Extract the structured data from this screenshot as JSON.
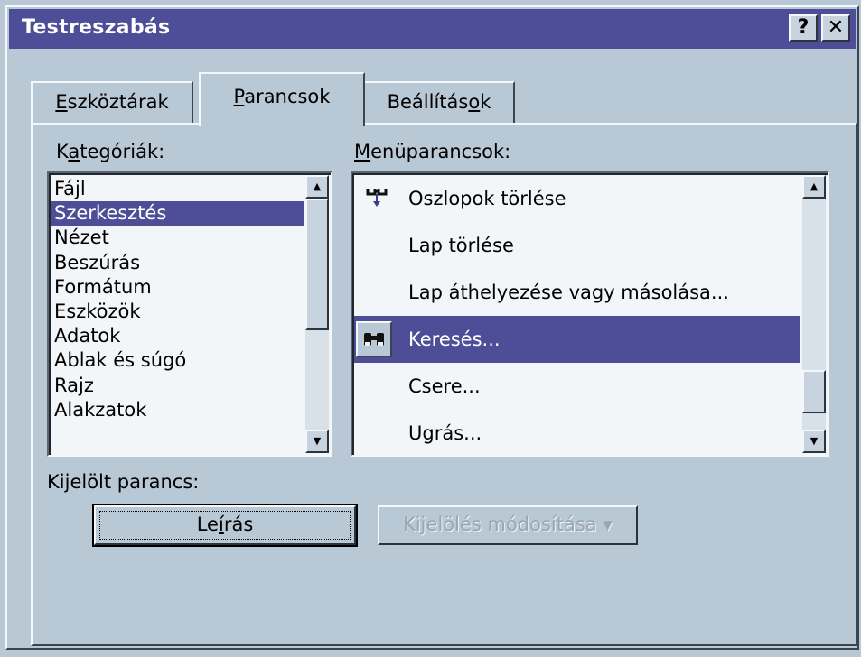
{
  "window": {
    "title": "Testreszabás",
    "help_label": "?",
    "close_label": "✕"
  },
  "tabs": [
    {
      "pre": "",
      "acc": "E",
      "post": "szköztárak"
    },
    {
      "pre": "",
      "acc": "P",
      "post": "arancsok"
    },
    {
      "pre": "Beállítás",
      "acc": "o",
      "post": "k"
    }
  ],
  "categories": {
    "label_pre": "K",
    "label_acc": "a",
    "label_post": "tegóriák:",
    "items": [
      "Fájl",
      "Szerkesztés",
      "Nézet",
      "Beszúrás",
      "Formátum",
      "Eszközök",
      "Adatok",
      "Ablak és súgó",
      "Rajz",
      "Alakzatok"
    ],
    "selected_index": 1
  },
  "commands": {
    "label_pre": "",
    "label_acc": "M",
    "label_post": "enüparancsok:",
    "items": [
      {
        "label": "Oszlopok törlése",
        "icon": "delete-columns-icon"
      },
      {
        "label": "Lap törlése",
        "icon": ""
      },
      {
        "label": "Lap áthelyezése vagy másolása...",
        "icon": ""
      },
      {
        "label": "Keresés...",
        "icon": "binoculars-icon"
      },
      {
        "label": "Csere...",
        "icon": ""
      },
      {
        "label": "Ugrás...",
        "icon": ""
      }
    ],
    "selected_index": 3
  },
  "selected_command": {
    "label": "Kijelölt parancs:",
    "description_pre": "Le",
    "description_acc": "í",
    "description_post": "rás",
    "modify_label": "Kijelölés módosítása",
    "modify_arrow": "▾"
  },
  "colors": {
    "titlebar": "#4d4e97",
    "selection": "#4d4e97",
    "face": "#b9c8d5"
  }
}
